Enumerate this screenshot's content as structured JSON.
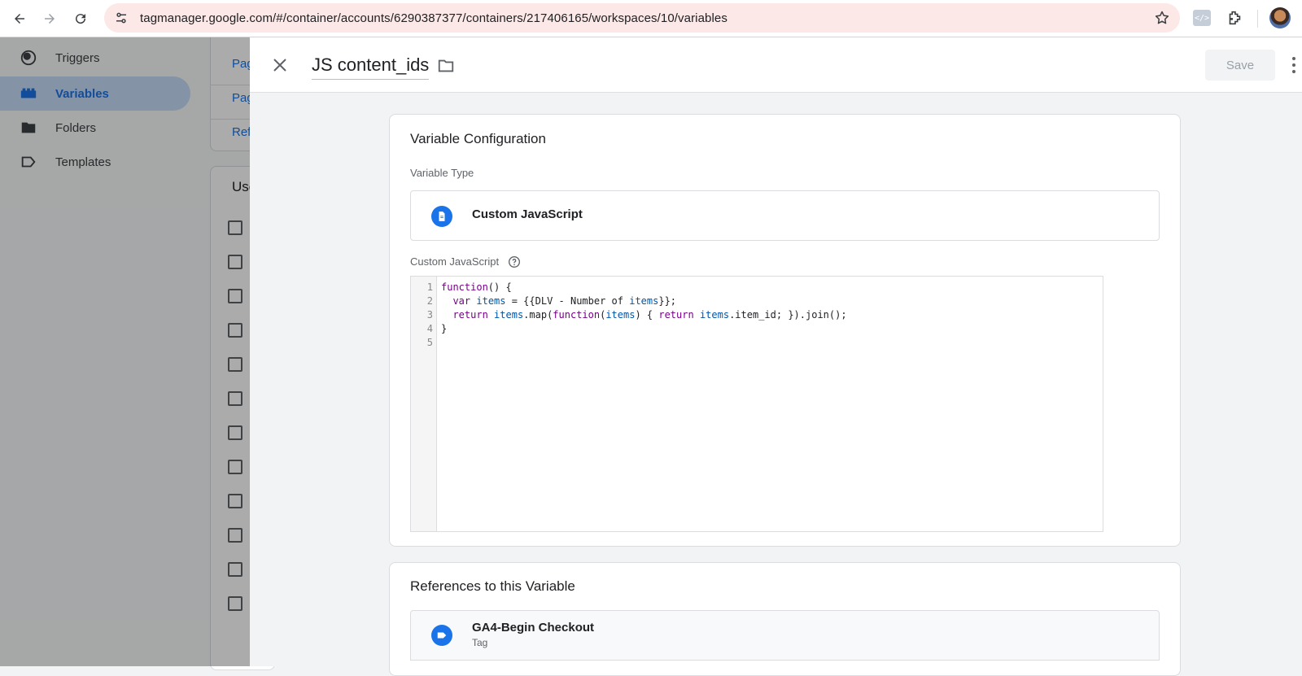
{
  "browser": {
    "url": "tagmanager.google.com/#/container/accounts/6290387377/containers/217406165/workspaces/10/variables",
    "ext_label": "</>"
  },
  "sidebar": {
    "items": [
      {
        "label": "Triggers",
        "icon": "triggers-icon",
        "active": false
      },
      {
        "label": "Variables",
        "icon": "variables-icon",
        "active": true
      },
      {
        "label": "Folders",
        "icon": "folder-icon",
        "active": false
      },
      {
        "label": "Templates",
        "icon": "templates-icon",
        "active": false
      }
    ]
  },
  "background_page": {
    "links": [
      "Pag",
      "Pag",
      "Ref"
    ],
    "section_title": "Use"
  },
  "panel": {
    "title": "JS content_ids",
    "save_label": "Save",
    "config": {
      "heading": "Variable Configuration",
      "type_label": "Variable Type",
      "type_value": "Custom JavaScript",
      "code_label": "Custom JavaScript",
      "line_numbers": [
        "1",
        "2",
        "3",
        "4",
        "5"
      ]
    },
    "references": {
      "heading": "References to this Variable",
      "items": [
        {
          "name": "GA4-Begin Checkout",
          "kind": "Tag"
        }
      ]
    }
  },
  "colors": {
    "accent": "#1a73e8",
    "active_nav_bg": "#c7dbfa",
    "url_bar_bg": "#fce8e6"
  }
}
